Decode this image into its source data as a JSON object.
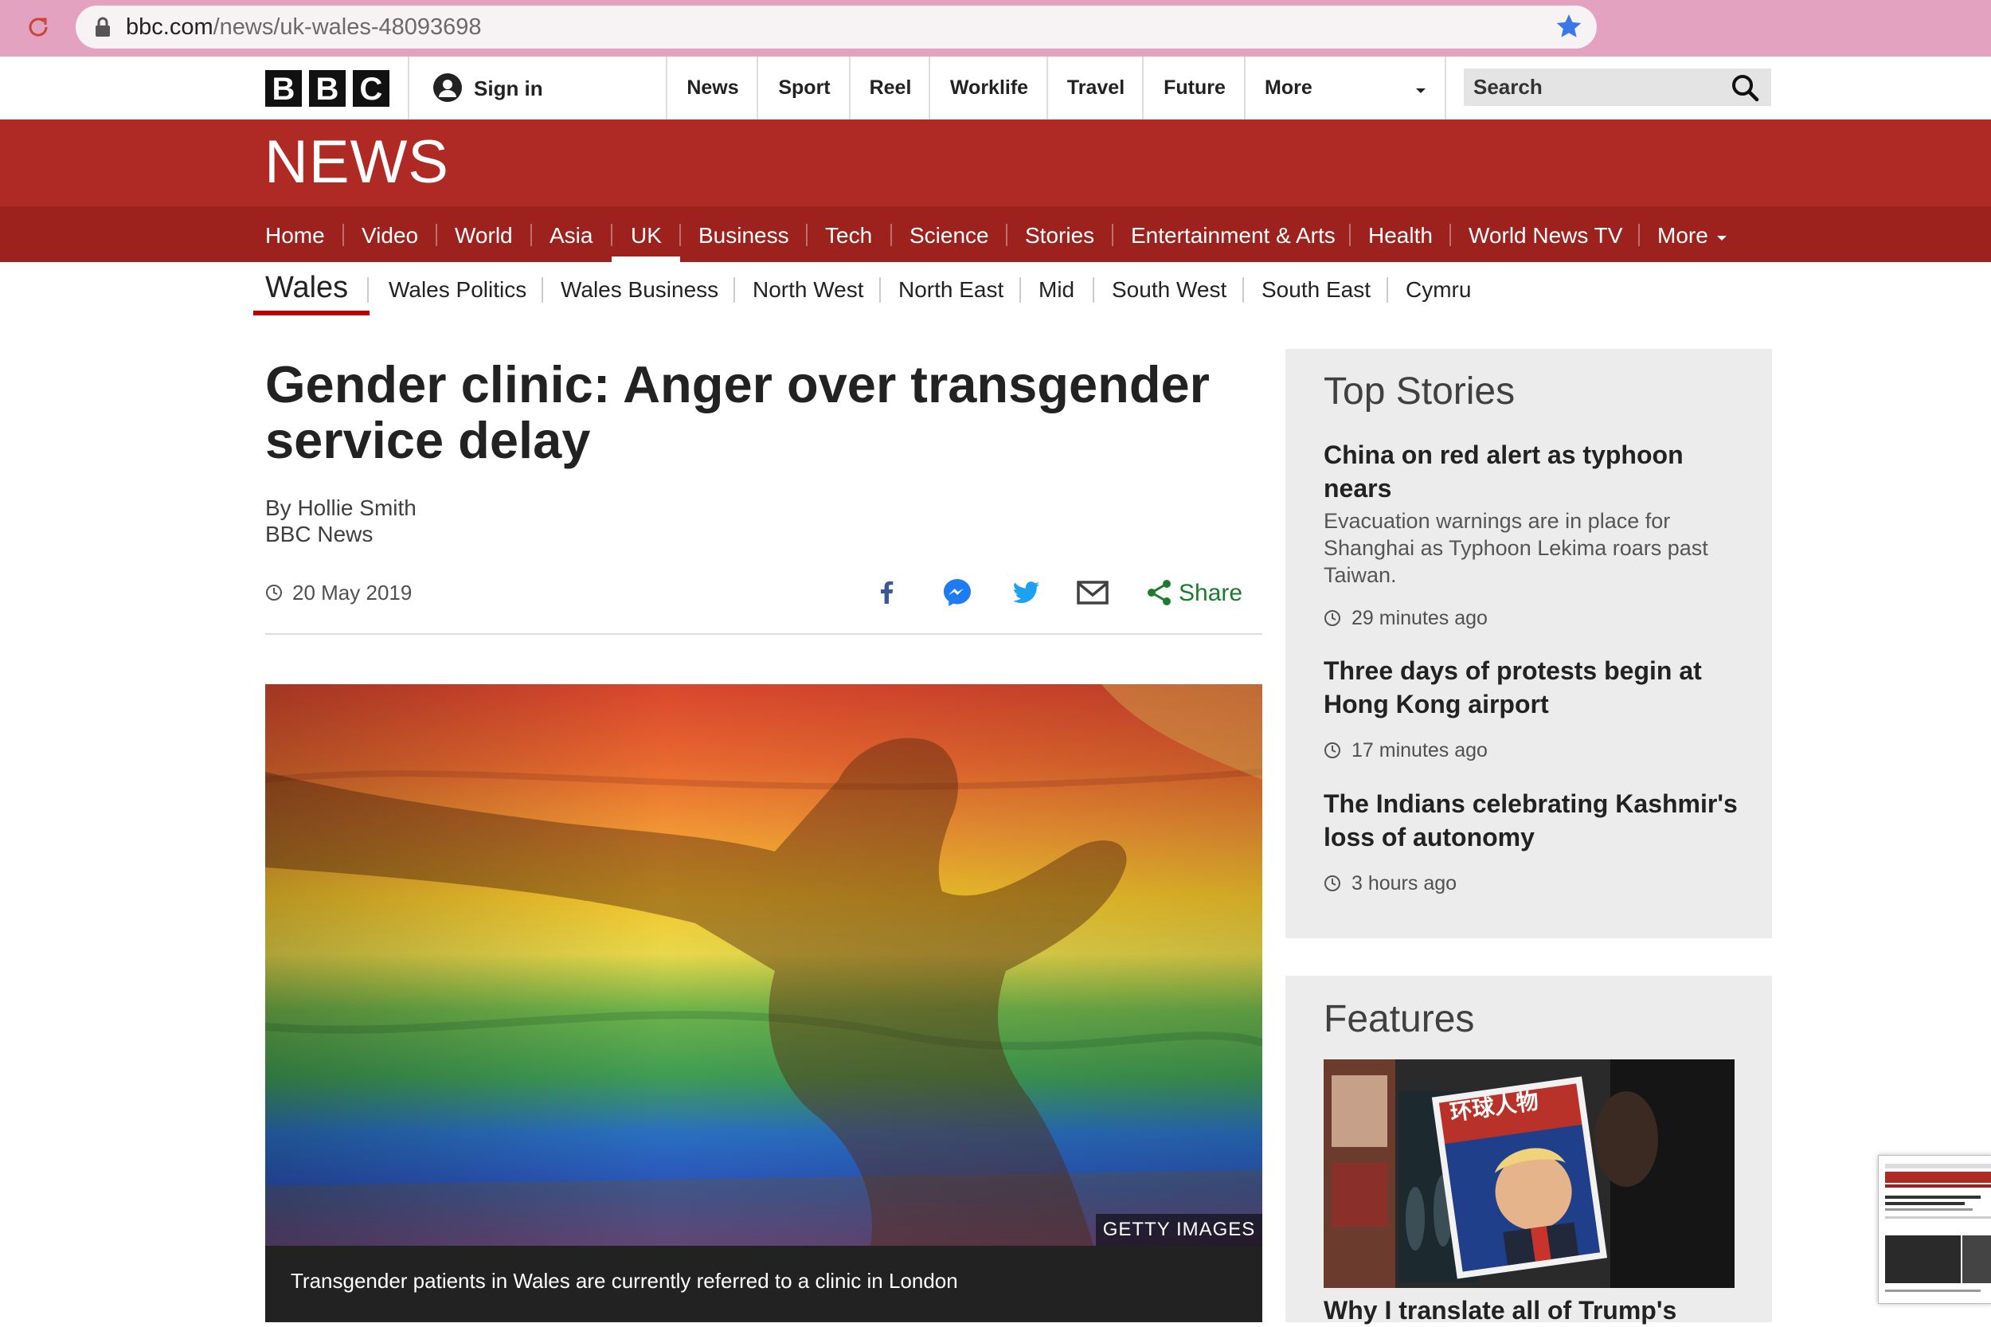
{
  "browser": {
    "url_domain": "bbc.com",
    "url_path": "/news/uk-wales-48093698"
  },
  "global_nav": {
    "logo_letters": [
      "B",
      "B",
      "C"
    ],
    "sign_in": "Sign in",
    "items": [
      "News",
      "Sport",
      "Reel",
      "Worklife",
      "Travel",
      "Future",
      "More"
    ],
    "search_placeholder": "Search"
  },
  "news_banner": {
    "logo": "NEWS",
    "nav": [
      "Home",
      "Video",
      "World",
      "Asia",
      "UK",
      "Business",
      "Tech",
      "Science",
      "Stories",
      "Entertainment & Arts",
      "Health",
      "World News TV",
      "More"
    ],
    "active": "UK"
  },
  "sub_nav": {
    "current": "Wales",
    "items": [
      "Wales Politics",
      "Wales Business",
      "North West",
      "North East",
      "Mid",
      "South West",
      "South East",
      "Cymru"
    ]
  },
  "article": {
    "headline": "Gender clinic: Anger over transgender service delay",
    "author": "By Hollie Smith",
    "outlet": "BBC News",
    "date": "20 May 2019",
    "share_label": "Share",
    "image_credit": "GETTY IMAGES",
    "image_caption": "Transgender patients in Wales are currently referred to a clinic in London"
  },
  "top_stories": {
    "title": "Top Stories",
    "stories": [
      {
        "headline": "China on red alert as typhoon nears",
        "summary": "Evacuation warnings are in place for Shanghai as Typhoon Lekima roars past Taiwan.",
        "time": "29 minutes ago"
      },
      {
        "headline": "Three days of protests begin at Hong Kong airport",
        "time": "17 minutes ago"
      },
      {
        "headline": "The Indians celebrating Kashmir's loss of autonomy",
        "time": "3 hours ago"
      }
    ]
  },
  "features": {
    "title": "Features",
    "magazine_text": "环球人物",
    "headline": "Why I translate all of Trump's"
  },
  "colors": {
    "bbc_red": "#b02a25",
    "nav_red": "#9d221e",
    "share_green": "#1f7a31",
    "chrome_pink": "#e3a2bf"
  },
  "icons": [
    "reload-icon",
    "lock-icon",
    "bookmark-star-icon",
    "user-icon",
    "chevron-down-icon",
    "search-icon",
    "clock-icon",
    "facebook-icon",
    "messenger-icon",
    "twitter-icon",
    "email-icon",
    "share-icon"
  ]
}
